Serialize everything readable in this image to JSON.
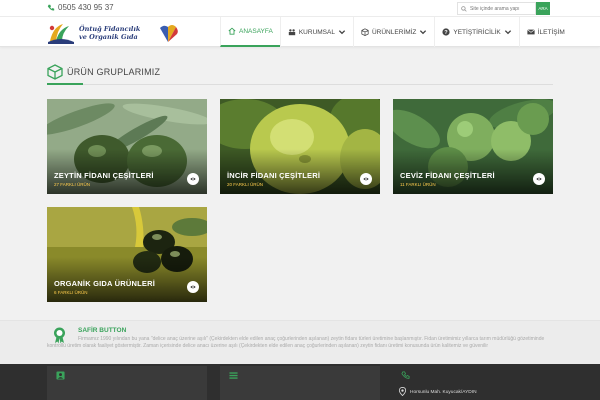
{
  "topbar": {
    "phone": "0505 430 95 37",
    "search_placeholder": "Site içinde arama yapı",
    "search_button": "ARA"
  },
  "logo": {
    "line1": "Öntuğ Fidancılık",
    "line2": "ve Organik Gıda"
  },
  "nav": {
    "items": [
      {
        "label": "ANASAYFA",
        "icon": "home-icon",
        "active": true
      },
      {
        "label": "KURUMSAL",
        "icon": "users-icon",
        "dropdown": true
      },
      {
        "label": "ÜRÜNLERİMİZ",
        "icon": "box-icon",
        "dropdown": true
      },
      {
        "label": "YETİŞTİRİCİLİK",
        "icon": "question-icon",
        "dropdown": true
      },
      {
        "label": "İLETİŞİM",
        "icon": "envelope-icon"
      }
    ]
  },
  "section": {
    "title": "ÜRÜN GRUPLARIMIZ"
  },
  "cards": [
    {
      "title": "ZEYTİN FİDANI ÇEŞİTLERİ",
      "count": "27 FARKLI ÜRÜN"
    },
    {
      "title": "İNCİR FİDANI ÇEŞİTLERİ",
      "count": "20 FARKLI ÜRÜN"
    },
    {
      "title": "CEVİZ FİDANI ÇEŞİTLERİ",
      "count": "11 FARKLI ÜRÜN"
    },
    {
      "title": "ORGANİK GIDA ÜRÜNLERİ",
      "count": "6 FARKLI ÜRÜN"
    }
  ],
  "info": {
    "title": "SAFİR BUTTON",
    "text": "Firmamız 1990 yılından bu yana \"delice anaç üzerine aşılı\" (Çekirdekten elde edilen anaç çoğurlerinden aşılanan) zeytin fidanı türleri üretimine başlanmıştır. Fidan üretimimiz yıllarca tarım müdürlüğü gözetiminde kontrollü üretim olarak faaliyet göstermiştir. Zaman içerisinde delice anacı üzerine aşılı (Çekirdekten elde edilen anaç çoğurlerinden aşılanan) zeytin fidanı üretimi konusunda ürün kalitemiz ve güvenilir"
  },
  "footer": {
    "address": "Horsunlu Mah. Kuyucak/AYDIN"
  },
  "colors": {
    "accent": "#3aa35b",
    "footer_bg": "#2f2f2f"
  }
}
